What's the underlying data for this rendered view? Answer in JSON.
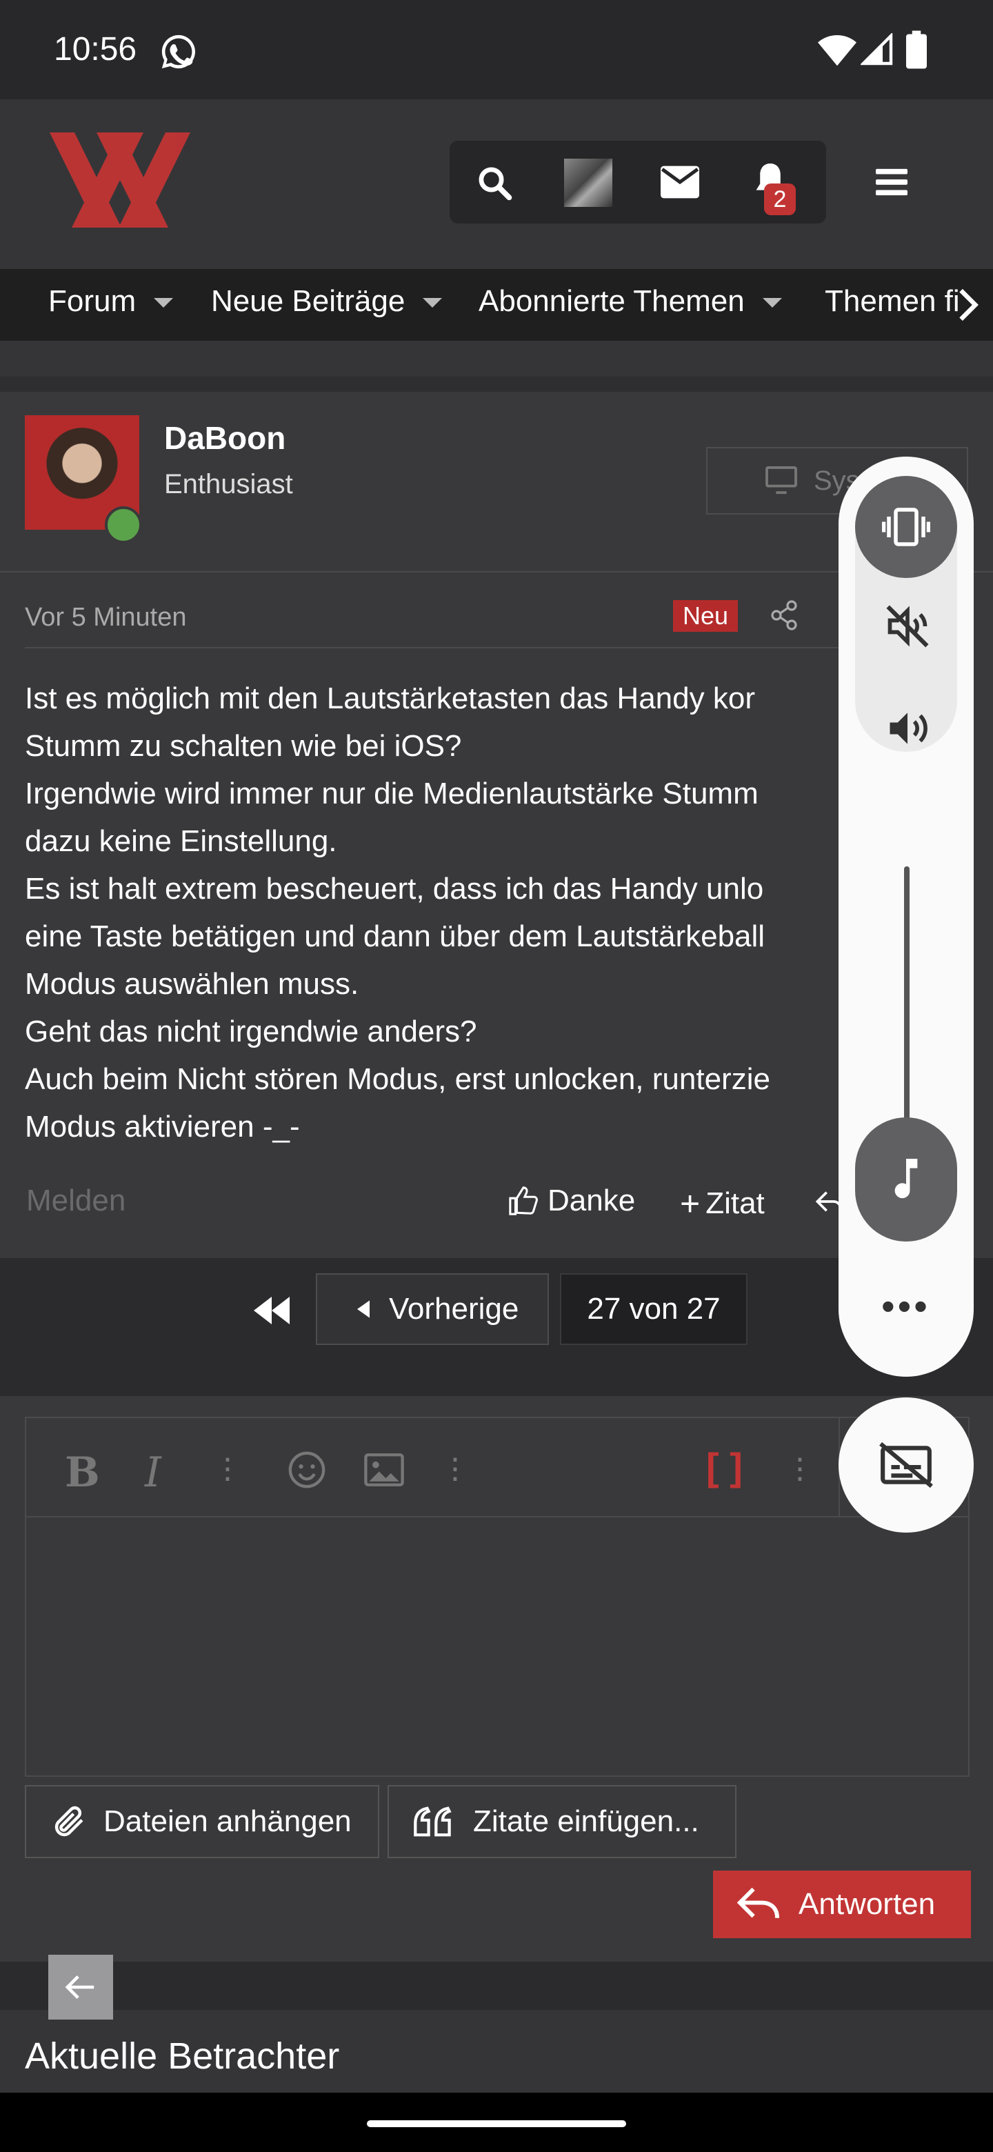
{
  "status_bar": {
    "time": "10:56"
  },
  "header": {
    "logo_alt": "XX",
    "notification_count": "2"
  },
  "nav": {
    "items": [
      "Forum",
      "Neue Beiträge",
      "Abonnierte Themen",
      "Themen fi"
    ]
  },
  "post": {
    "author": "DaBoon",
    "role": "Enthusiast",
    "system_button": "Sys",
    "time": "Vor 5 Minuten",
    "new_badge": "Neu",
    "lines": [
      "Ist es möglich mit den Lautstärketasten das Handy kor",
      "Stumm zu schalten wie bei iOS?",
      "Irgendwie wird immer nur die Medienlautstärke Stumm",
      "dazu keine Einstellung.",
      "Es ist halt extrem bescheuert, dass ich das Handy unlo",
      "eine Taste betätigen und dann über dem Lautstärkeball",
      "Modus auswählen muss.",
      "Geht das nicht irgendwie anders?",
      "Auch beim Nicht stören Modus, erst unlocken, runterzie",
      "Modus aktivieren -_-"
    ],
    "report": "Melden",
    "thanks": "Danke",
    "quote": "Zitat"
  },
  "pagination": {
    "previous": "Vorherige",
    "page_info": "27 von 27"
  },
  "editor": {
    "attach": "Dateien anhängen",
    "insert_quotes": "Zitate einfügen...",
    "reply": "Antworten"
  },
  "footer": {
    "current_viewers": "Aktuelle Betrachter"
  },
  "colors": {
    "accent_red": "#c23434",
    "badge_red": "#b52b2b",
    "panel_bg": "#fafafa",
    "panel_icon_bg": "#606062",
    "online_green": "#5ba34a"
  }
}
